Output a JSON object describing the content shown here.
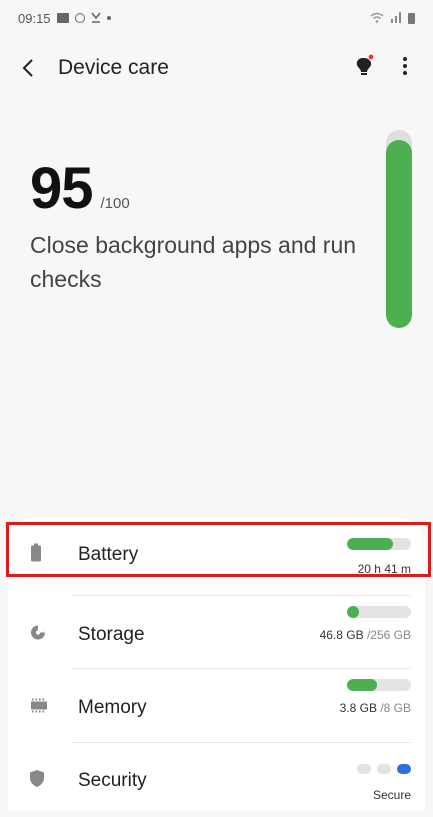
{
  "status_bar": {
    "time": "09:15",
    "left_icons": [
      "gallery-icon",
      "circle-icon",
      "download-icon",
      "dot-icon"
    ],
    "right_icons": [
      "wifi-icon",
      "signal-icon",
      "battery-icon"
    ]
  },
  "app_bar": {
    "title": "Device care",
    "back_icon": "back-arrow-icon",
    "tip_icon": "lightbulb-icon",
    "more_icon": "more-vertical-icon",
    "accent": "#e53935"
  },
  "score": {
    "value": "95",
    "max": "/100",
    "message": "Close background apps and run checks",
    "level": 0.95,
    "color": "#4caf50"
  },
  "items": [
    {
      "label": "Battery",
      "value": "20 h 41 m",
      "unit": "",
      "icon": "battery-icon",
      "fill": 0.72
    },
    {
      "label": "Storage",
      "value": "46.8 GB",
      "unit": " /256 GB",
      "icon": "pie-chart-icon",
      "fill": 0.18
    },
    {
      "label": "Memory",
      "value": "3.8 GB",
      "unit": " /8 GB",
      "icon": "memory-chip-icon",
      "fill": 0.47
    },
    {
      "label": "Security",
      "value": "Secure",
      "unit": "",
      "icon": "shield-icon",
      "fill": null
    }
  ],
  "colors": {
    "bar_fill": "#4caf50",
    "bar_track": "#e3e3e3",
    "security_active": "#2f6fdc",
    "highlight": "#e01a1a"
  }
}
